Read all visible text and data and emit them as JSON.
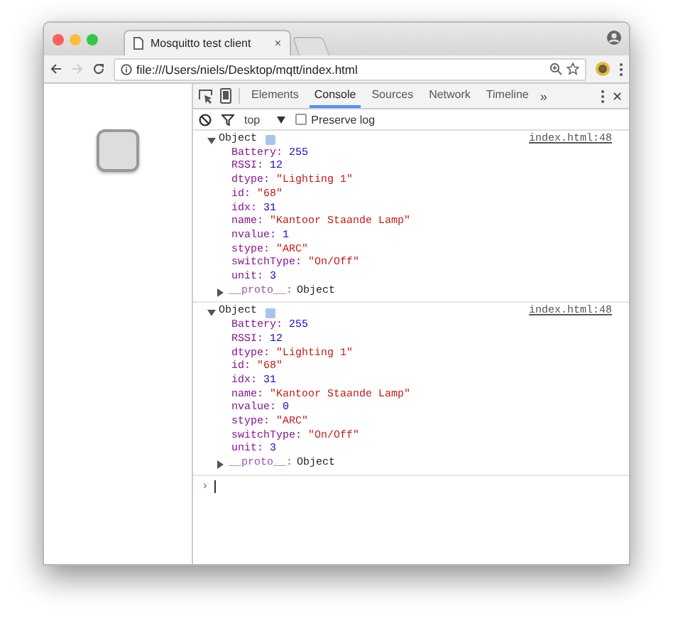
{
  "window": {
    "title": "Mosquitto test client",
    "close": "×"
  },
  "toolbar": {
    "url": "file:///Users/niels/Desktop/mqtt/index.html",
    "forward_disabled": true
  },
  "devtools": {
    "tabs": [
      {
        "label": "Elements",
        "selected": false
      },
      {
        "label": "Console",
        "selected": true
      },
      {
        "label": "Sources",
        "selected": false
      },
      {
        "label": "Network",
        "selected": false
      },
      {
        "label": "Timeline",
        "selected": false
      }
    ],
    "more": "»",
    "close": "✕",
    "context": "top",
    "preserve_log": {
      "label": "Preserve log",
      "checked": false
    },
    "entries": [
      {
        "header": "Object",
        "source": "index.html:48",
        "expanded": true,
        "properties": [
          {
            "key": "Battery:",
            "value": "255",
            "kind": "number"
          },
          {
            "key": "RSSI:",
            "value": "12",
            "kind": "number"
          },
          {
            "key": "dtype:",
            "value": "\"Lighting 1\"",
            "kind": "string"
          },
          {
            "key": "id:",
            "value": "\"68\"",
            "kind": "string"
          },
          {
            "key": "idx:",
            "value": "31",
            "kind": "number"
          },
          {
            "key": "name:",
            "value": "\"Kantoor Staande Lamp\"",
            "kind": "string"
          },
          {
            "key": "nvalue:",
            "value": "1",
            "kind": "number"
          },
          {
            "key": "stype:",
            "value": "\"ARC\"",
            "kind": "string"
          },
          {
            "key": "switchType:",
            "value": "\"On/Off\"",
            "kind": "string"
          },
          {
            "key": "unit:",
            "value": "3",
            "kind": "number"
          }
        ],
        "proto": {
          "key": "__proto__:",
          "value": "Object",
          "expanded": false
        }
      },
      {
        "header": "Object",
        "source": "index.html:48",
        "expanded": true,
        "properties": [
          {
            "key": "Battery:",
            "value": "255",
            "kind": "number"
          },
          {
            "key": "RSSI:",
            "value": "12",
            "kind": "number"
          },
          {
            "key": "dtype:",
            "value": "\"Lighting 1\"",
            "kind": "string"
          },
          {
            "key": "id:",
            "value": "\"68\"",
            "kind": "string"
          },
          {
            "key": "idx:",
            "value": "31",
            "kind": "number"
          },
          {
            "key": "name:",
            "value": "\"Kantoor Staande Lamp\"",
            "kind": "string"
          },
          {
            "key": "nvalue:",
            "value": "0",
            "kind": "number"
          },
          {
            "key": "stype:",
            "value": "\"ARC\"",
            "kind": "string"
          },
          {
            "key": "switchType:",
            "value": "\"On/Off\"",
            "kind": "string"
          },
          {
            "key": "unit:",
            "value": "3",
            "kind": "number"
          }
        ],
        "proto": {
          "key": "__proto__:",
          "value": "Object",
          "expanded": false
        }
      }
    ],
    "prompt": "›"
  }
}
